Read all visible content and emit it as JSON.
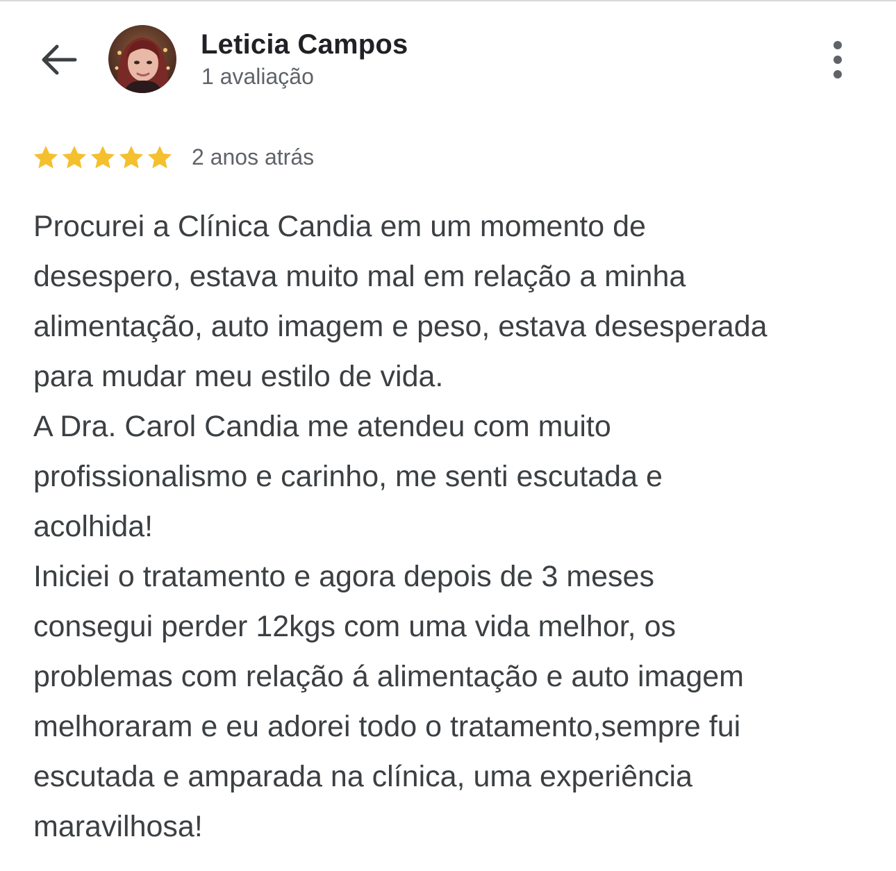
{
  "header": {
    "back_icon": "arrow-left-icon",
    "reviewer_name": "Leticia Campos",
    "review_count": "1 avaliação",
    "more_icon": "more-vertical-icon"
  },
  "review": {
    "rating": 5,
    "rating_max": 5,
    "star_color": "#f4c02e",
    "time": "2 anos atrás",
    "lines": [
      "Procurei a Clínica Candia em um momento de",
      "desespero, estava muito mal em relação a minha",
      "alimentação, auto imagem e peso, estava desesperada",
      "para mudar meu estilo de vida.",
      "A Dra. Carol Candia me atendeu com muito",
      "profissionalismo e carinho, me senti escutada e",
      "acolhida!",
      "Iniciei o tratamento e agora depois de 3 meses",
      "consegui perder 12kgs com uma vida melhor, os",
      "problemas com relação á alimentação e auto imagem",
      "melhoraram e eu adorei todo o tratamento,sempre fui",
      "escutada e amparada na clínica, uma experiência",
      "maravilhosa!"
    ]
  },
  "colors": {
    "text_primary": "#202124",
    "text_secondary": "#5f6368",
    "text_body": "#3c4043"
  }
}
